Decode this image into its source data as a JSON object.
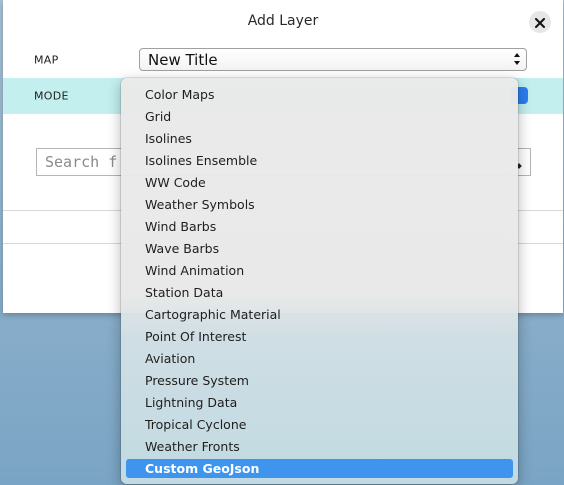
{
  "modal": {
    "title": "Add Layer",
    "close_icon": "close-icon"
  },
  "map_row": {
    "label": "MAP",
    "select_value": "New Title"
  },
  "mode_row": {
    "label": "MODE"
  },
  "search": {
    "placeholder": "Search f"
  },
  "dropdown": {
    "items": [
      "Color Maps",
      "Grid",
      "Isolines",
      "Isolines Ensemble",
      "WW Code",
      "Weather Symbols",
      "Wind Barbs",
      "Wave Barbs",
      "Wind Animation",
      "Station Data",
      "Cartographic Material",
      "Point Of Interest",
      "Aviation",
      "Pressure System",
      "Lightning Data",
      "Tropical Cyclone",
      "Weather Fronts",
      "Custom GeoJson"
    ],
    "selected_index": 17
  },
  "colors": {
    "mode_row_bg": "#c3f0ef",
    "selection_bg": "#3f94ee"
  }
}
